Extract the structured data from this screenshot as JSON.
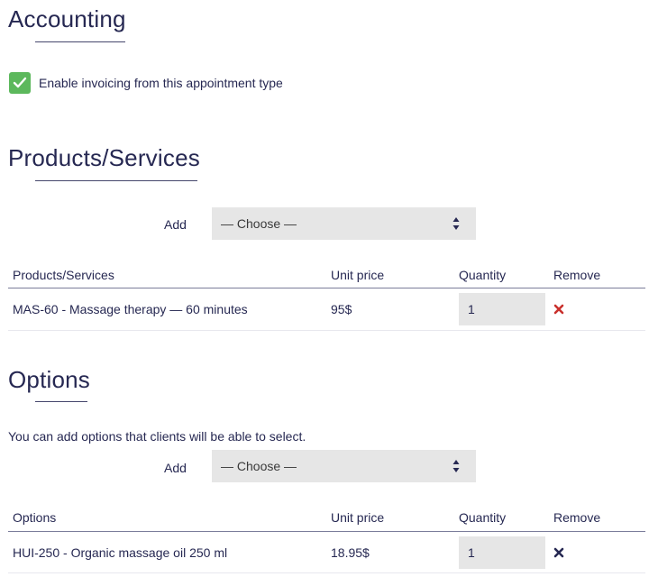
{
  "accounting": {
    "title": "Accounting",
    "enable_invoicing": {
      "checked": true,
      "label": "Enable invoicing from this appointment type"
    }
  },
  "products": {
    "title": "Products/Services",
    "add_label": "Add",
    "select_value": "— Choose —",
    "columns": [
      "Products/Services",
      "Unit price",
      "Quantity",
      "Remove"
    ],
    "rows": [
      {
        "name": "MAS-60 - Massage therapy — 60 minutes",
        "unit_price": "95$",
        "quantity": "1",
        "remove_icon": "remove-x-icon-red"
      }
    ]
  },
  "options": {
    "title": "Options",
    "note": "You can add options that clients will be able to select.",
    "add_label": "Add",
    "select_value": "— Choose —",
    "columns": [
      "Options",
      "Unit price",
      "Quantity",
      "Remove"
    ],
    "rows": [
      {
        "name": "HUI-250 - Organic massage oil 250 ml",
        "unit_price": "18.95$",
        "quantity": "1",
        "remove_icon": "remove-x-icon-dark"
      }
    ]
  },
  "colors": {
    "heading": "#262852",
    "checkbox": "#5cb85c",
    "remove_red": "#c9302c",
    "remove_dark": "#262852",
    "field_bg": "#e6e6e6"
  }
}
